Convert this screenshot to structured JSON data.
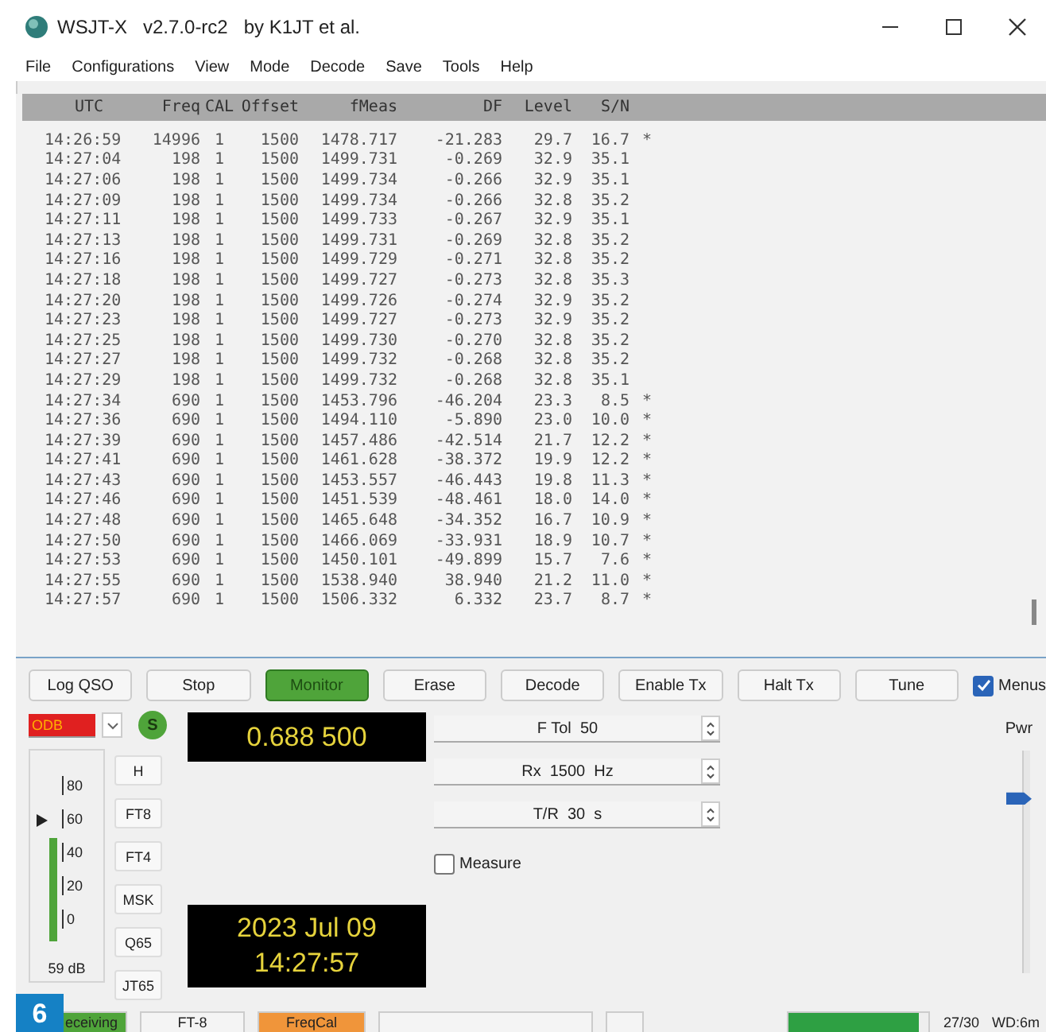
{
  "window": {
    "title": "WSJT-X   v2.7.0-rc2   by K1JT et al."
  },
  "menu": [
    "File",
    "Configurations",
    "View",
    "Mode",
    "Decode",
    "Save",
    "Tools",
    "Help"
  ],
  "table": {
    "columns": [
      "UTC",
      "Freq",
      "CAL",
      "Offset",
      "fMeas",
      "DF",
      "Level",
      "S/N"
    ],
    "rows": [
      [
        "14:26:59",
        "14996",
        "1",
        "1500",
        "1478.717",
        "-21.283",
        "29.7",
        "16.7",
        "*"
      ],
      [
        "14:27:04",
        "198",
        "1",
        "1500",
        "1499.731",
        "-0.269",
        "32.9",
        "35.1"
      ],
      [
        "14:27:06",
        "198",
        "1",
        "1500",
        "1499.734",
        "-0.266",
        "32.9",
        "35.1"
      ],
      [
        "14:27:09",
        "198",
        "1",
        "1500",
        "1499.734",
        "-0.266",
        "32.8",
        "35.2"
      ],
      [
        "14:27:11",
        "198",
        "1",
        "1500",
        "1499.733",
        "-0.267",
        "32.9",
        "35.1"
      ],
      [
        "14:27:13",
        "198",
        "1",
        "1500",
        "1499.731",
        "-0.269",
        "32.8",
        "35.2"
      ],
      [
        "14:27:16",
        "198",
        "1",
        "1500",
        "1499.729",
        "-0.271",
        "32.8",
        "35.2"
      ],
      [
        "14:27:18",
        "198",
        "1",
        "1500",
        "1499.727",
        "-0.273",
        "32.8",
        "35.3"
      ],
      [
        "14:27:20",
        "198",
        "1",
        "1500",
        "1499.726",
        "-0.274",
        "32.9",
        "35.2"
      ],
      [
        "14:27:23",
        "198",
        "1",
        "1500",
        "1499.727",
        "-0.273",
        "32.9",
        "35.2"
      ],
      [
        "14:27:25",
        "198",
        "1",
        "1500",
        "1499.730",
        "-0.270",
        "32.8",
        "35.2"
      ],
      [
        "14:27:27",
        "198",
        "1",
        "1500",
        "1499.732",
        "-0.268",
        "32.8",
        "35.2"
      ],
      [
        "14:27:29",
        "198",
        "1",
        "1500",
        "1499.732",
        "-0.268",
        "32.8",
        "35.1"
      ],
      [
        "14:27:34",
        "690",
        "1",
        "1500",
        "1453.796",
        "-46.204",
        "23.3",
        "8.5",
        "*"
      ],
      [
        "14:27:36",
        "690",
        "1",
        "1500",
        "1494.110",
        "-5.890",
        "23.0",
        "10.0",
        "*"
      ],
      [
        "14:27:39",
        "690",
        "1",
        "1500",
        "1457.486",
        "-42.514",
        "21.7",
        "12.2",
        "*"
      ],
      [
        "14:27:41",
        "690",
        "1",
        "1500",
        "1461.628",
        "-38.372",
        "19.9",
        "12.2",
        "*"
      ],
      [
        "14:27:43",
        "690",
        "1",
        "1500",
        "1453.557",
        "-46.443",
        "19.8",
        "11.3",
        "*"
      ],
      [
        "14:27:46",
        "690",
        "1",
        "1500",
        "1451.539",
        "-48.461",
        "18.0",
        "14.0",
        "*"
      ],
      [
        "14:27:48",
        "690",
        "1",
        "1500",
        "1465.648",
        "-34.352",
        "16.7",
        "10.9",
        "*"
      ],
      [
        "14:27:50",
        "690",
        "1",
        "1500",
        "1466.069",
        "-33.931",
        "18.9",
        "10.7",
        "*"
      ],
      [
        "14:27:53",
        "690",
        "1",
        "1500",
        "1450.101",
        "-49.899",
        "15.7",
        "7.6",
        "*"
      ],
      [
        "14:27:55",
        "690",
        "1",
        "1500",
        "1538.940",
        "38.940",
        "21.2",
        "11.0",
        "*"
      ],
      [
        "14:27:57",
        "690",
        "1",
        "1500",
        "1506.332",
        "6.332",
        "23.7",
        "8.7",
        "*"
      ]
    ]
  },
  "buttons": [
    {
      "label": "Log QSO",
      "on": false
    },
    {
      "label": "Stop",
      "on": false
    },
    {
      "label": "Monitor",
      "on": true
    },
    {
      "label": "Erase",
      "on": false
    },
    {
      "label": "Decode",
      "on": false
    },
    {
      "label": "Enable Tx",
      "on": false
    },
    {
      "label": "Halt Tx",
      "on": false
    },
    {
      "label": "Tune",
      "on": false
    }
  ],
  "menus_checkbox": {
    "label": "Menus",
    "checked": true
  },
  "band": {
    "value": "ODB"
  },
  "spot_button": {
    "label": "S"
  },
  "frequency": "0.688 500",
  "spinners": [
    "F Tol  50",
    "Rx  1500  Hz",
    "T/R  30  s"
  ],
  "measure": {
    "label": "Measure",
    "checked": false
  },
  "meter": {
    "ticks": [
      "80",
      "60",
      "40",
      "20",
      "0"
    ],
    "level": 0.66,
    "reading": "59 dB"
  },
  "modes": [
    "H",
    "FT8",
    "FT4",
    "MSK",
    "Q65",
    "JT65"
  ],
  "clock": {
    "date": "2023 Jul 09",
    "time": "14:27:57"
  },
  "power": {
    "label": "Pwr",
    "level": 0.8
  },
  "status_bar": {
    "items": [
      {
        "text": "eceiving",
        "kind": "green"
      },
      {
        "text": "FT-8",
        "kind": "plain"
      },
      {
        "text": "FreqCal",
        "kind": "orange"
      },
      {
        "kind": "plain"
      },
      {
        "kind": "small"
      }
    ],
    "progress": {
      "level": 0.93
    },
    "count": "27/30",
    "wd": "WD:6m"
  },
  "figure_label": "6"
}
